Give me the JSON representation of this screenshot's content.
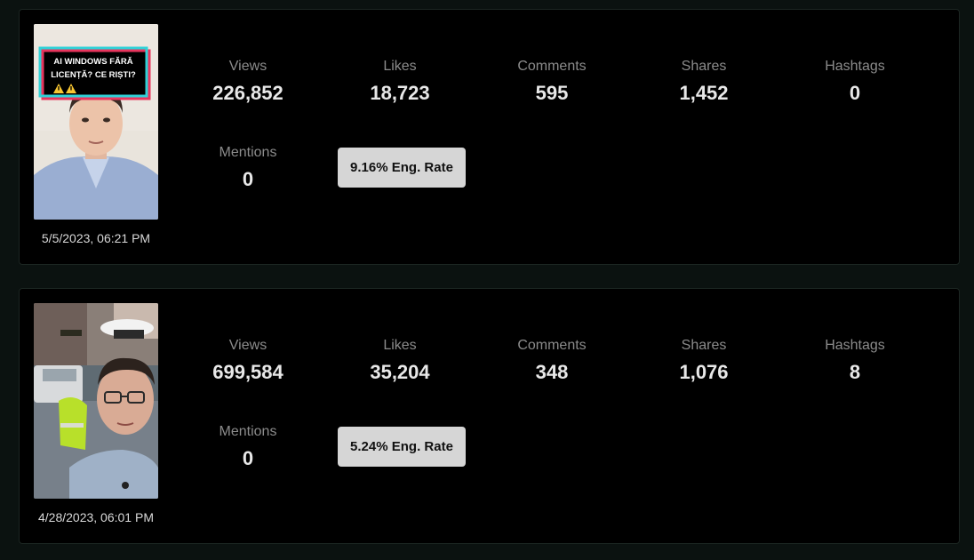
{
  "posts": [
    {
      "thumbnail_caption_line1": "AI WINDOWS FĂRĂ",
      "thumbnail_caption_line2": "LICENȚĂ? CE RIȘTI?",
      "thumbnail_icon": "warning-icon",
      "date": "5/5/2023, 06:21 PM",
      "stats": {
        "views": {
          "label": "Views",
          "value": "226,852"
        },
        "likes": {
          "label": "Likes",
          "value": "18,723"
        },
        "comments": {
          "label": "Comments",
          "value": "595"
        },
        "shares": {
          "label": "Shares",
          "value": "1,452"
        },
        "hashtags": {
          "label": "Hashtags",
          "value": "0"
        },
        "mentions": {
          "label": "Mentions",
          "value": "0"
        }
      },
      "engagement_rate": "9.16% Eng. Rate"
    },
    {
      "date": "4/28/2023, 06:01 PM",
      "stats": {
        "views": {
          "label": "Views",
          "value": "699,584"
        },
        "likes": {
          "label": "Likes",
          "value": "35,204"
        },
        "comments": {
          "label": "Comments",
          "value": "348"
        },
        "shares": {
          "label": "Shares",
          "value": "1,076"
        },
        "hashtags": {
          "label": "Hashtags",
          "value": "8"
        },
        "mentions": {
          "label": "Mentions",
          "value": "0"
        }
      },
      "engagement_rate": "5.24% Eng. Rate"
    }
  ],
  "colors": {
    "page_background": "#0b1210",
    "card_background": "#000000",
    "badge_background": "#d6d6d6",
    "label_text": "#8b8b8b",
    "value_text": "#e8e8e8"
  }
}
